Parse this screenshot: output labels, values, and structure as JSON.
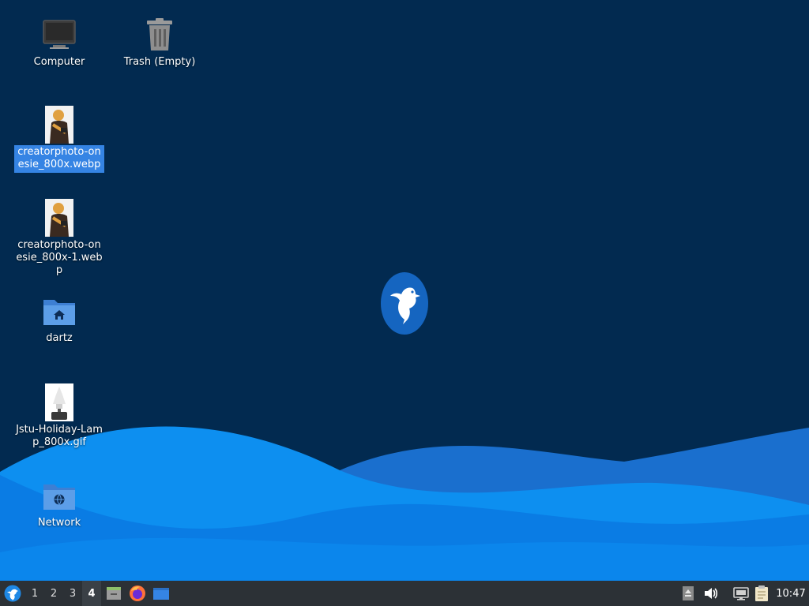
{
  "desktop": {
    "icons": [
      {
        "label": "Computer",
        "icon": "computer-icon"
      },
      {
        "label": "Trash (Empty)",
        "icon": "trash-icon"
      },
      {
        "label": "creatorphoto-onesie_800x.webp",
        "icon": "image-thumbnail-icon",
        "selected": true
      },
      {
        "label": "creatorphoto-onesie_800x-1.webp",
        "icon": "image-thumbnail-icon"
      },
      {
        "label": "dartz",
        "icon": "home-folder-icon"
      },
      {
        "label": "Jstu-Holiday-Lamp_800x.gif",
        "icon": "image-thumbnail-icon"
      },
      {
        "label": "Network",
        "icon": "network-folder-icon"
      }
    ],
    "logo": "hummingbird-logo-icon"
  },
  "panel": {
    "menu_icon": "start-menu-icon",
    "workspaces": [
      "1",
      "2",
      "3",
      "4"
    ],
    "active_workspace": "4",
    "launchers": [
      "file-manager-icon",
      "firefox-icon",
      "desktop-icon"
    ],
    "tray_icons": [
      "eject-icon",
      "volume-icon",
      "network-icon",
      "clipboard-icon"
    ],
    "clock": "10:47"
  },
  "colors": {
    "background": "#022a50",
    "selection": "#3584e4",
    "panel": "#2c3136"
  }
}
